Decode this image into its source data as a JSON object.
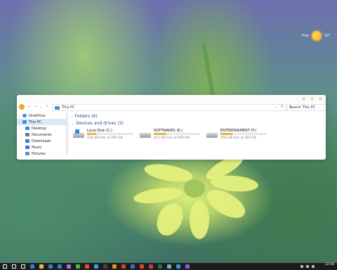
{
  "weather": {
    "city": "Hue",
    "temperature": "32°"
  },
  "window": {
    "address": {
      "path": "This PC"
    },
    "search": {
      "placeholder": "Search This PC"
    }
  },
  "sidebar": {
    "items": [
      {
        "label": "OneDrive",
        "icon": "cloud-icon",
        "color": "#4a90d9"
      },
      {
        "label": "This PC",
        "icon": "computer-icon",
        "color": "#3d8fd9",
        "selected": true
      },
      {
        "label": "Desktop",
        "icon": "desktop-folder-icon",
        "color": "#3a8fd9"
      },
      {
        "label": "Documents",
        "icon": "documents-folder-icon",
        "color": "#6c7a8a"
      },
      {
        "label": "Downloads",
        "icon": "downloads-folder-icon",
        "color": "#2f7fc9"
      },
      {
        "label": "Music",
        "icon": "music-folder-icon",
        "color": "#4a6fd1"
      },
      {
        "label": "Pictures",
        "icon": "pictures-folder-icon",
        "color": "#5a8fc9"
      }
    ]
  },
  "main": {
    "folders_header": "Folders (6)",
    "devices_header": "Devices and drives (3)",
    "drives": [
      {
        "name": "Local Disk (C:)",
        "free": "234 GB free of 291 GB",
        "used_fraction": 0.2,
        "windows": true
      },
      {
        "name": "SOFTWARES (E:)",
        "free": "211 GB free of 292 GB",
        "used_fraction": 0.28,
        "windows": false
      },
      {
        "name": "ENTERTAINMENT (F:)",
        "free": "256 GB free of 345 GB",
        "used_fraction": 0.26,
        "windows": false
      }
    ]
  },
  "taskbar": {
    "icons": [
      {
        "name": "start-icon",
        "color": "#ffffff"
      },
      {
        "name": "search-icon",
        "color": "#ffffff"
      },
      {
        "name": "task-view-icon",
        "color": "#ffffff"
      },
      {
        "name": "edge-icon",
        "color": "#2f7fd0"
      },
      {
        "name": "file-explorer-icon",
        "color": "#e6b84a"
      },
      {
        "name": "store-icon",
        "color": "#2f7fd0"
      },
      {
        "name": "mail-icon",
        "color": "#2f7fd0"
      },
      {
        "name": "premiere-icon",
        "color": "#9b6fe0"
      },
      {
        "name": "app-green-icon",
        "color": "#4caf50"
      },
      {
        "name": "chrome-icon",
        "color": "#e04b3c"
      },
      {
        "name": "photoshop-icon",
        "color": "#2fa0e6"
      },
      {
        "name": "app-dark-icon",
        "color": "#444444"
      },
      {
        "name": "illustrator-icon",
        "color": "#e08a2b"
      },
      {
        "name": "acrobat-icon",
        "color": "#d63b2f"
      },
      {
        "name": "word-icon",
        "color": "#2f6fc9"
      },
      {
        "name": "powerpoint-icon",
        "color": "#d24726"
      },
      {
        "name": "app-red-icon",
        "color": "#c93a3a"
      },
      {
        "name": "excel-icon",
        "color": "#217346"
      },
      {
        "name": "media-icon",
        "color": "#6fa8dc"
      },
      {
        "name": "app-blue-icon",
        "color": "#3d8fd9"
      },
      {
        "name": "app-purple-icon",
        "color": "#8e5cd6"
      }
    ],
    "time": "22:06"
  }
}
